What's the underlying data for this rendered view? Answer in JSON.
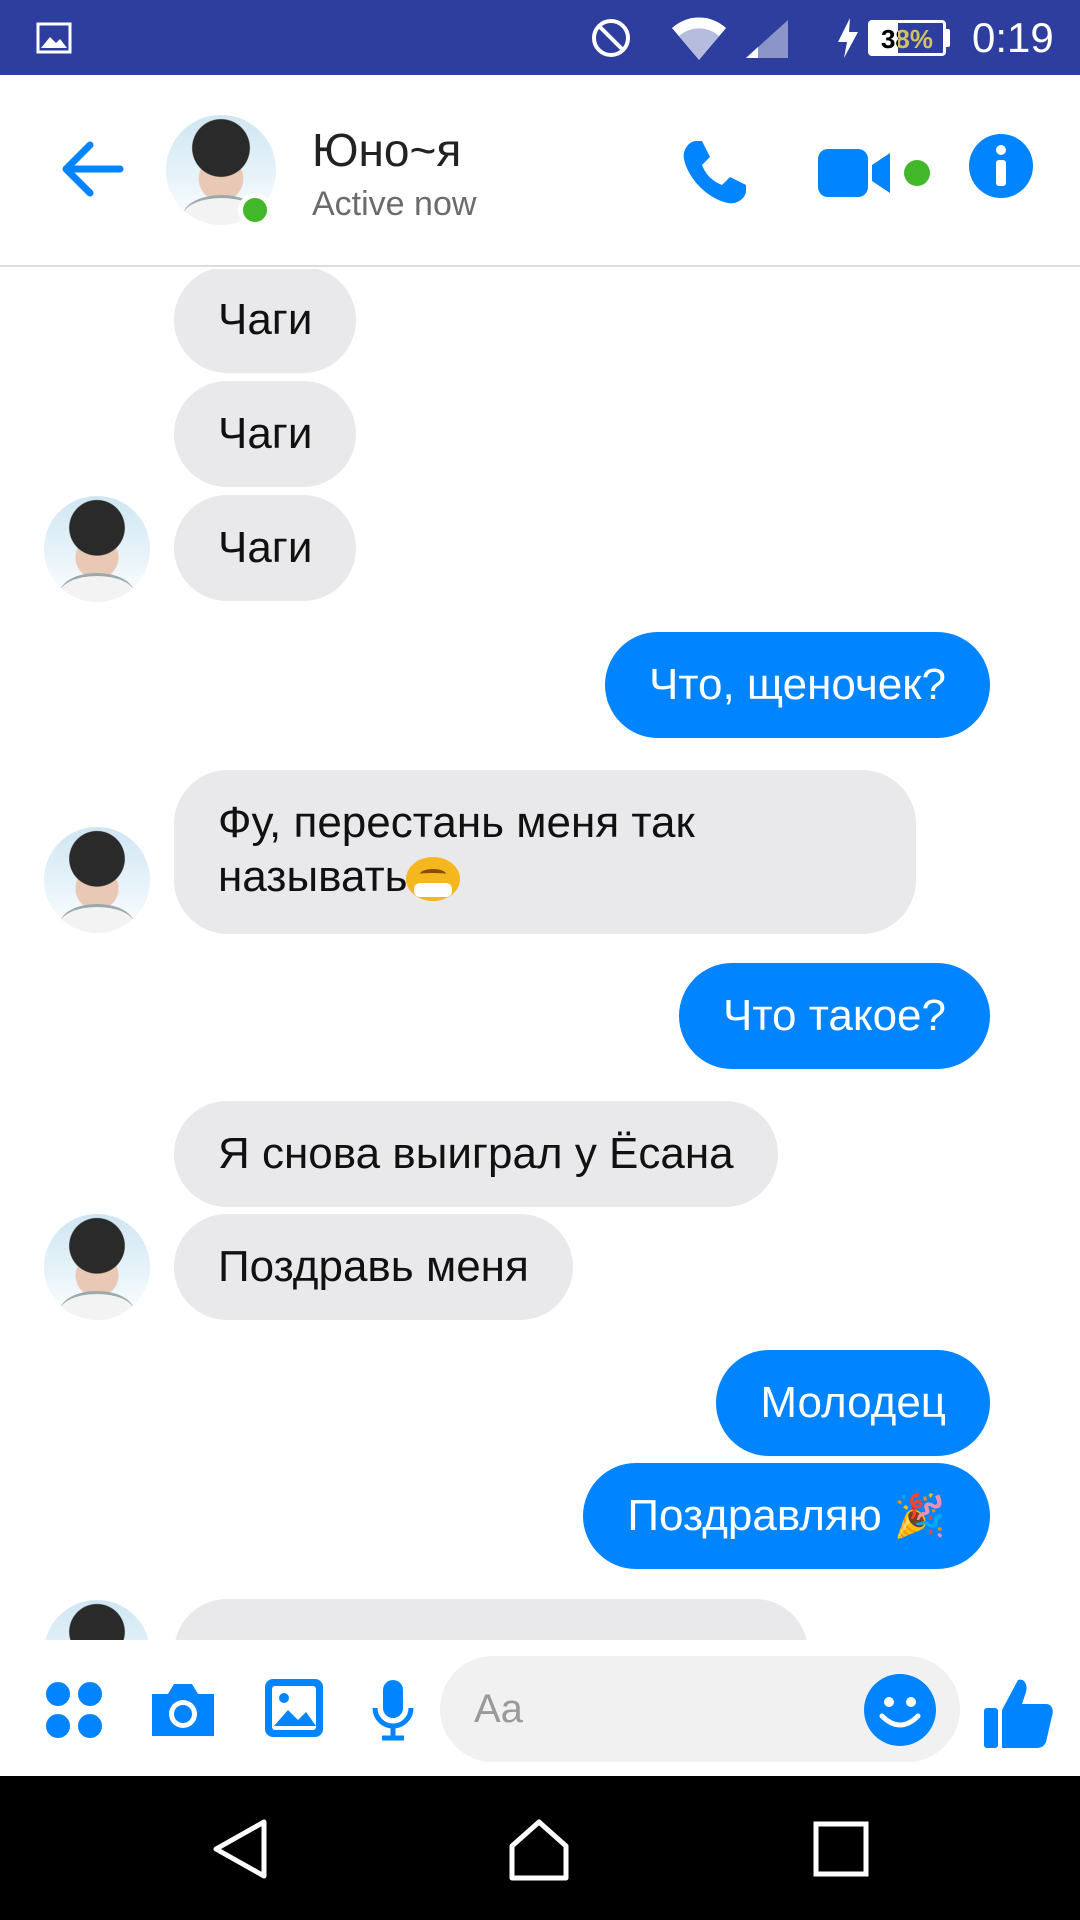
{
  "status_bar": {
    "battery_percent": "38%",
    "battery_level": 0.38,
    "time": "0:19"
  },
  "header": {
    "contact_name": "Юно~я",
    "contact_status": "Active now",
    "accent_color": "#0084ff",
    "online_color": "#42b72a"
  },
  "messages": [
    {
      "direction": "in",
      "text": "Чаги"
    },
    {
      "direction": "in",
      "text": "Чаги"
    },
    {
      "direction": "in",
      "text": "Чаги"
    },
    {
      "direction": "out",
      "text": "Что, щеночек?"
    },
    {
      "direction": "in",
      "text_line1": "Фу, перестань меня так",
      "text_line2": "называть",
      "emoji": "face-with-mask-emoji"
    },
    {
      "direction": "out",
      "text": "Что такое?"
    },
    {
      "direction": "in",
      "text": "Я снова выиграл у Ёсана"
    },
    {
      "direction": "in",
      "text": "Поздравь меня"
    },
    {
      "direction": "out",
      "text": "Молодец"
    },
    {
      "direction": "out",
      "text": "Поздравляю",
      "emoji": "party-popper-emoji"
    }
  ],
  "composer": {
    "placeholder": "Aa"
  },
  "icons": {
    "back": "back-arrow-icon",
    "phone": "phone-icon",
    "video": "video-camera-icon",
    "info": "info-icon",
    "apps": "apps-grid-icon",
    "camera": "camera-icon",
    "gallery": "gallery-icon",
    "mic": "microphone-icon",
    "emoji": "smiley-icon",
    "like": "thumbs-up-icon"
  }
}
